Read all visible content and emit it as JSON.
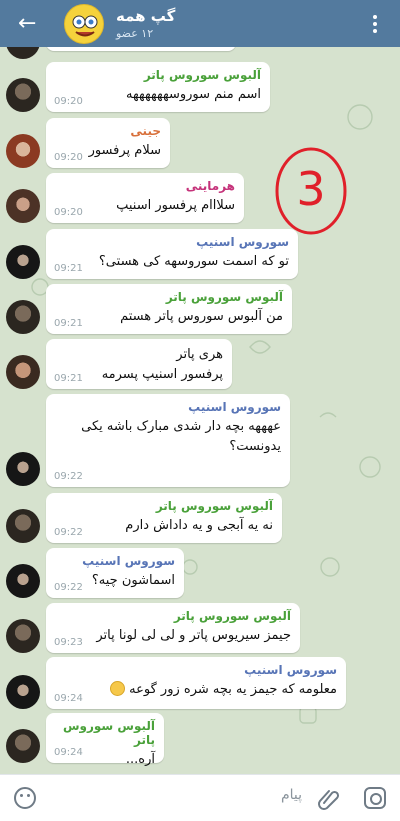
{
  "header": {
    "title": "گپ همه",
    "subtitle": "۱۲ عضو",
    "back_icon": "arrow-left-icon",
    "menu_icon": "more-vertical-icon",
    "group_avatar": "spongebob-avatar"
  },
  "colors": {
    "header": "#537a9e",
    "albus": "#4aa13a",
    "ginny": "#d8703b",
    "hermione": "#c5327a",
    "snape": "#5774b6"
  },
  "messages": [
    {
      "sender": "آلبوس سوروس پاتر",
      "text": "اسم منم سوروسههههههه",
      "time": "09:20",
      "avatar": "albus"
    },
    {
      "sender": "جینی",
      "text": "سلام پرفسور",
      "time": "09:20",
      "avatar": "ginny"
    },
    {
      "sender": "هرماینی",
      "text": "سلااام پرفسور اسنیپ",
      "time": "09:20",
      "avatar": "hermione"
    },
    {
      "sender": "سوروس اسنیپ",
      "text": "تو که اسمت سوروسهه کی هستی؟",
      "time": "09:21",
      "avatar": "snape"
    },
    {
      "sender": "آلبوس سوروس پاتر",
      "text": "من آلبوس سوروس پاتر هستم",
      "time": "09:21",
      "avatar": "albus"
    },
    {
      "sender": "هری پاتر",
      "text": "پرفسور اسنیپ پسرمه",
      "time": "09:21",
      "avatar": "harry"
    },
    {
      "sender": "سوروس اسنیپ",
      "text": "عهههه بچه دار شدی مبارک باشه یکی یدونست؟",
      "time": "09:22",
      "avatar": "snape"
    },
    {
      "sender": "آلبوس سوروس پاتر",
      "text": "نه یه آبجی و یه داداش دارم",
      "time": "09:22",
      "avatar": "albus"
    },
    {
      "sender": "سوروس اسنیپ",
      "text": "اسماشون چیه؟",
      "time": "09:22",
      "avatar": "snape"
    },
    {
      "sender": "آلبوس سوروس پاتر",
      "text": "جیمز سیریوس پاتر و لی لی لونا پاتر",
      "time": "09:23",
      "avatar": "albus"
    },
    {
      "sender": "سوروس اسنیپ",
      "text": "معلومه که جیمز یه بچه شره زور گوعه",
      "time": "09:24",
      "avatar": "snape",
      "emoji": "rolling-eyes-emoji"
    },
    {
      "sender": "آلبوس سوروس پاتر",
      "text": "آره...",
      "time": "09:24",
      "avatar": "albus"
    }
  ],
  "overlay_mark": "3",
  "composer": {
    "placeholder": "پیام",
    "emoji_icon": "emoji-icon",
    "attach_icon": "paperclip-icon",
    "camera_icon": "camera-icon"
  }
}
